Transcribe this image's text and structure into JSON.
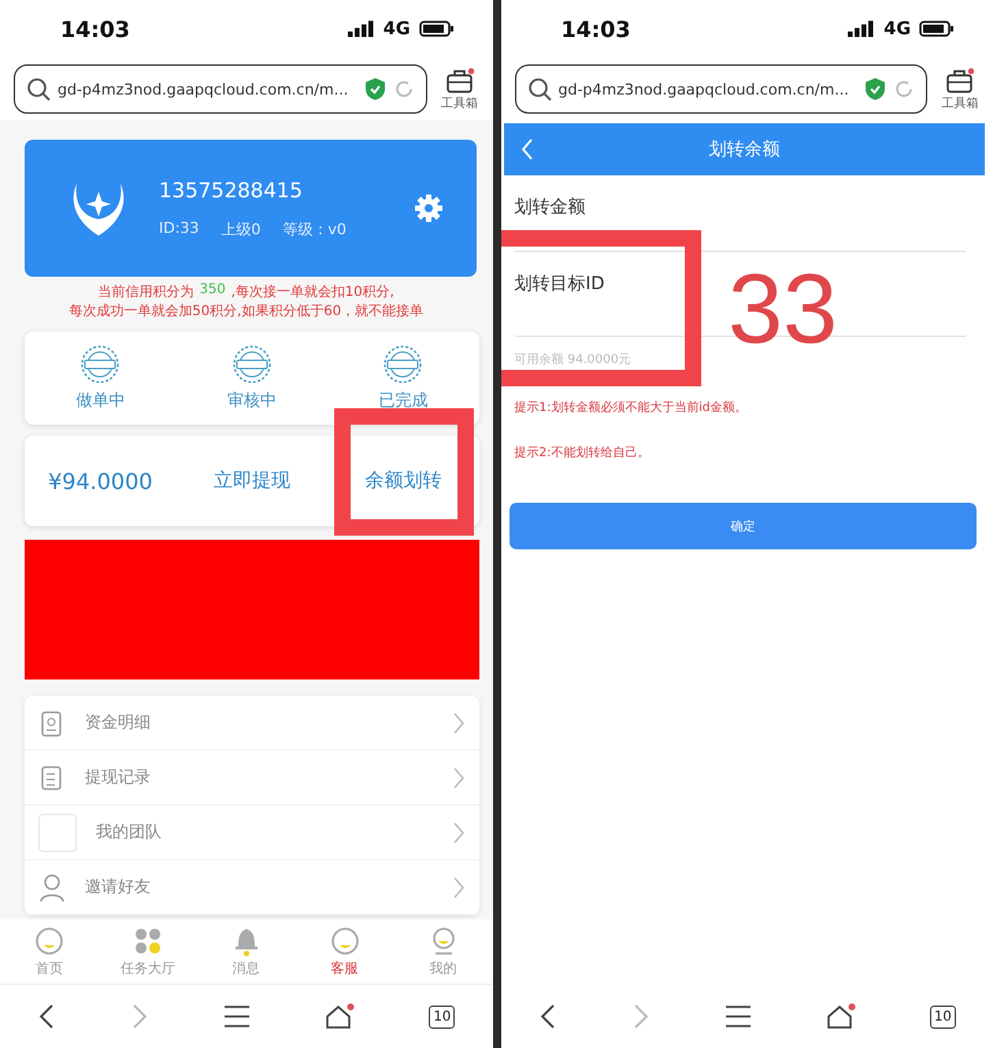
{
  "phones": [
    {
      "kind": "account",
      "status_bar": {
        "time": "14:03",
        "network": "4G"
      },
      "browser": {
        "url": "gd-p4mz3nod.gaapqcloud.com.cn/m...",
        "toolbox": "工具箱"
      },
      "profile": {
        "phone": "13575288415",
        "id": "ID:33",
        "parent": "上级0",
        "level": "等级：v0"
      },
      "notice": {
        "prefix": "当前信用积分为",
        "score": "350",
        "suffix": ",每次接一单就会扣10积分,",
        "line2": "每次成功一单就会加50积分,如果积分低于60，就不能接单"
      },
      "order_states": [
        {
          "label": "做单中"
        },
        {
          "label": "审核中"
        },
        {
          "label": "已完成"
        }
      ],
      "balance": {
        "amount": "¥94.0000",
        "withdraw": "立即提现",
        "transfer": "余额划转"
      },
      "menu": [
        {
          "label": "资金明细",
          "kind": "document"
        },
        {
          "label": "提现记录",
          "kind": "list"
        },
        {
          "label": "我的团队",
          "kind": "blank"
        },
        {
          "label": "邀请好友",
          "kind": "person"
        }
      ],
      "tabbar": [
        {
          "label": "首页",
          "kind": "face",
          "selected": false
        },
        {
          "label": "任务大厅",
          "kind": "dots",
          "selected": false
        },
        {
          "label": "消息",
          "kind": "bell",
          "selected": false
        },
        {
          "label": "客服",
          "kind": "face",
          "selected": true
        },
        {
          "label": "我的",
          "kind": "lamp",
          "selected": false
        }
      ],
      "nav": {
        "tabs": "10"
      },
      "annotations": [
        {
          "kind": "box"
        }
      ]
    },
    {
      "kind": "transfer",
      "status_bar": {
        "time": "14:03",
        "network": "4G"
      },
      "browser": {
        "url": "gd-p4mz3nod.gaapqcloud.com.cn/m...",
        "toolbox": "工具箱"
      },
      "header": {
        "title": "划转余额"
      },
      "fields": [
        {
          "label": "划转金额"
        },
        {
          "label": "划转目标ID"
        }
      ],
      "available": "可用余额 94.0000元",
      "tips": [
        "提示1:划转金额必须不能大于当前id金额。",
        "提示2:不能划转给自己。"
      ],
      "confirm": "确定",
      "nav": {
        "tabs": "10"
      },
      "annotations": [
        {
          "kind": "box"
        },
        {
          "kind": "text",
          "text": "33"
        }
      ]
    }
  ]
}
